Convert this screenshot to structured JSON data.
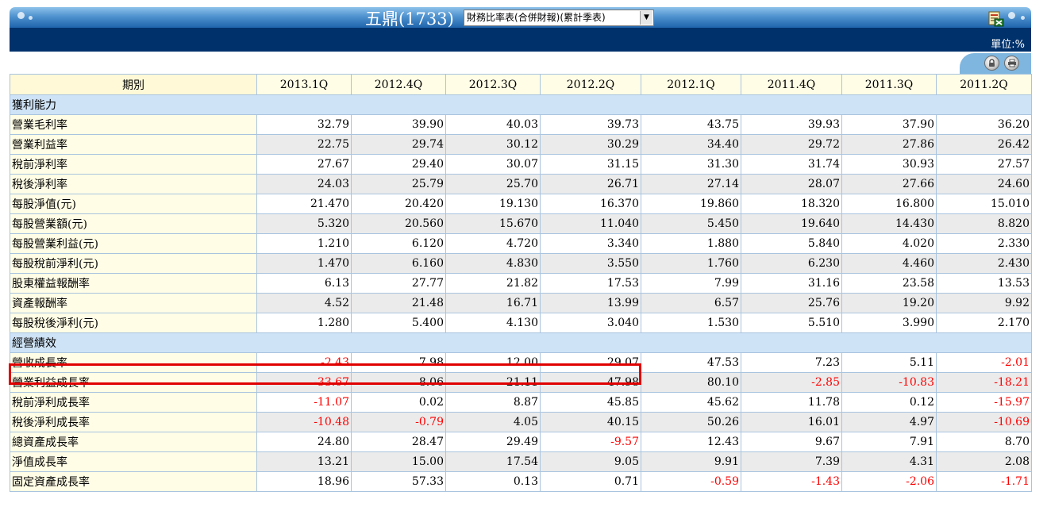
{
  "header": {
    "company_name": "五鼎",
    "stock_code": "1733",
    "title_display": "五鼎(1733)",
    "report_select_value": "財務比率表(合併財報)(累計季表)",
    "unit_label": "單位:%",
    "export_icon": "excel-export-icon",
    "lock_icon": "lock-icon",
    "print_icon": "print-icon"
  },
  "table": {
    "period_header": "期別",
    "periods": [
      "2013.1Q",
      "2012.4Q",
      "2012.3Q",
      "2012.2Q",
      "2012.1Q",
      "2011.4Q",
      "2011.3Q",
      "2011.2Q"
    ],
    "sections": [
      {
        "name": "獲利能力",
        "rows": [
          {
            "label": "營業毛利率",
            "values": [
              "32.79",
              "39.90",
              "40.03",
              "39.73",
              "43.75",
              "39.93",
              "37.90",
              "36.20"
            ]
          },
          {
            "label": "營業利益率",
            "values": [
              "22.75",
              "29.74",
              "30.12",
              "30.29",
              "34.40",
              "29.72",
              "27.86",
              "26.42"
            ]
          },
          {
            "label": "稅前淨利率",
            "values": [
              "27.67",
              "29.40",
              "30.07",
              "31.15",
              "31.30",
              "31.74",
              "30.93",
              "27.57"
            ]
          },
          {
            "label": "稅後淨利率",
            "values": [
              "24.03",
              "25.79",
              "25.70",
              "26.71",
              "27.14",
              "28.07",
              "27.66",
              "24.60"
            ]
          },
          {
            "label": "每股淨值(元)",
            "values": [
              "21.470",
              "20.420",
              "19.130",
              "16.370",
              "19.860",
              "18.320",
              "16.800",
              "15.010"
            ]
          },
          {
            "label": "每股營業額(元)",
            "values": [
              "5.320",
              "20.560",
              "15.670",
              "11.040",
              "5.450",
              "19.640",
              "14.430",
              "8.820"
            ]
          },
          {
            "label": "每股營業利益(元)",
            "values": [
              "1.210",
              "6.120",
              "4.720",
              "3.340",
              "1.880",
              "5.840",
              "4.020",
              "2.330"
            ]
          },
          {
            "label": "每股稅前淨利(元)",
            "values": [
              "1.470",
              "6.160",
              "4.830",
              "3.550",
              "1.760",
              "6.230",
              "4.460",
              "2.430"
            ]
          },
          {
            "label": "股東權益報酬率",
            "values": [
              "6.13",
              "27.77",
              "21.82",
              "17.53",
              "7.99",
              "31.16",
              "23.58",
              "13.53"
            ]
          },
          {
            "label": "資產報酬率",
            "values": [
              "4.52",
              "21.48",
              "16.71",
              "13.99",
              "6.57",
              "25.76",
              "19.20",
              "9.92"
            ]
          },
          {
            "label": "每股稅後淨利(元)",
            "values": [
              "1.280",
              "5.400",
              "4.130",
              "3.040",
              "1.530",
              "5.510",
              "3.990",
              "2.170"
            ]
          }
        ]
      },
      {
        "name": "經營績效",
        "rows": [
          {
            "label": "營收成長率",
            "values": [
              "-2.43",
              "7.98",
              "12.00",
              "29.07",
              "47.53",
              "7.23",
              "5.11",
              "-2.01"
            ]
          },
          {
            "label": "營業利益成長率",
            "values": [
              "-33.67",
              "8.06",
              "21.11",
              "47.98",
              "80.10",
              "-2.85",
              "-10.83",
              "-18.21"
            ]
          },
          {
            "label": "稅前淨利成長率",
            "values": [
              "-11.07",
              "0.02",
              "8.87",
              "45.85",
              "45.62",
              "11.78",
              "0.12",
              "-15.97"
            ]
          },
          {
            "label": "稅後淨利成長率",
            "values": [
              "-10.48",
              "-0.79",
              "4.05",
              "40.15",
              "50.26",
              "16.01",
              "4.97",
              "-10.69"
            ]
          },
          {
            "label": "總資產成長率",
            "values": [
              "24.80",
              "28.47",
              "29.49",
              "-9.57",
              "12.43",
              "9.67",
              "7.91",
              "8.70"
            ]
          },
          {
            "label": "淨值成長率",
            "values": [
              "13.21",
              "15.00",
              "17.54",
              "9.05",
              "9.91",
              "7.39",
              "4.31",
              "2.08"
            ]
          },
          {
            "label": "固定資產成長率",
            "values": [
              "18.96",
              "57.33",
              "0.13",
              "0.71",
              "-0.59",
              "-1.43",
              "-2.06",
              "-1.71"
            ]
          }
        ]
      }
    ]
  },
  "colors": {
    "negative": "#ff0000",
    "highlight_border": "#e00000",
    "header_dark": "#00316a",
    "section_bg": "#cfe3f6",
    "label_bg": "#fffde6"
  }
}
